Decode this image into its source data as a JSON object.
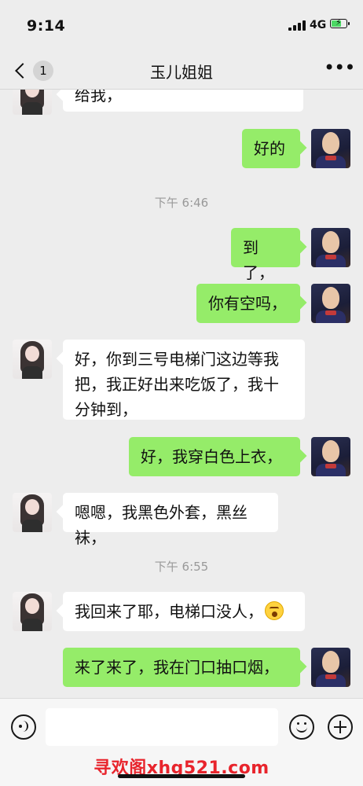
{
  "status_bar": {
    "time": "9:14",
    "network": "4G"
  },
  "nav": {
    "unread_count": "1",
    "title": "玉儿姐姐"
  },
  "messages": [
    {
      "side": "in",
      "text": "给我，"
    },
    {
      "side": "out",
      "text": "好的"
    },
    {
      "type": "time",
      "text": "下午 6:46"
    },
    {
      "side": "out",
      "text": "到了，"
    },
    {
      "side": "out",
      "text": "你有空吗，"
    },
    {
      "side": "in",
      "text": "好，你到三号电梯门这边等我把，我正好出来吃饭了，我十分钟到，"
    },
    {
      "side": "out",
      "text": "好，我穿白色上衣，"
    },
    {
      "side": "in",
      "text": "嗯嗯，我黑色外套，黑丝袜，"
    },
    {
      "type": "time",
      "text": "下午 6:55"
    },
    {
      "side": "in",
      "text": "我回来了耶，电梯口没人，",
      "emoji": "flushed-emoji"
    },
    {
      "side": "out",
      "text": "来了来了，我在门口抽口烟，"
    }
  ],
  "input": {
    "value": "",
    "placeholder": ""
  },
  "watermark": "寻欢阁xhg521.com",
  "colors": {
    "outgoing_bubble": "#95ec69",
    "incoming_bubble": "#ffffff",
    "background": "#ededed",
    "watermark": "#e8242c"
  },
  "icons": [
    "back-chevron-icon",
    "more-options-icon",
    "voice-icon",
    "emoji-icon",
    "plus-icon"
  ]
}
